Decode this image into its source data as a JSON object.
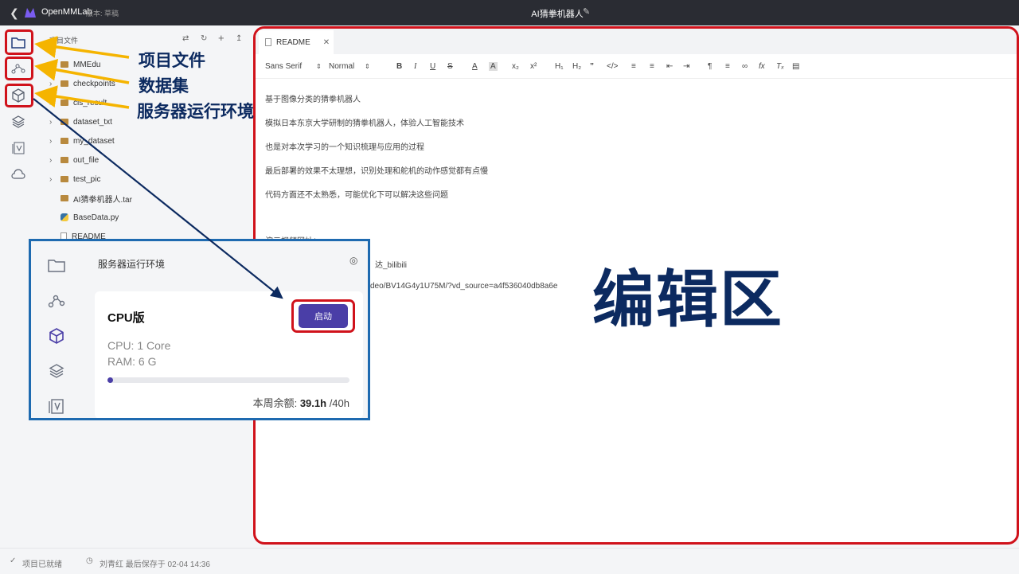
{
  "topbar": {
    "brand": "OpenMMLab",
    "version": "版本: 草稿",
    "title": "AI猜拳机器人"
  },
  "tree": {
    "title": "项目文件",
    "items": [
      {
        "type": "folder",
        "name": "MMEdu"
      },
      {
        "type": "folder",
        "name": "checkpoints"
      },
      {
        "type": "folder",
        "name": "cls_result"
      },
      {
        "type": "folder",
        "name": "dataset_txt"
      },
      {
        "type": "folder",
        "name": "my_dataset"
      },
      {
        "type": "folder",
        "name": "out_file"
      },
      {
        "type": "folder",
        "name": "test_pic"
      },
      {
        "type": "file",
        "name": "AI猜拳机器人.tar"
      },
      {
        "type": "python",
        "name": "BaseData.py"
      },
      {
        "type": "file",
        "name": "README"
      }
    ]
  },
  "annotations": {
    "project_files": "项目文件",
    "dataset": "数据集",
    "server_env": "服务器运行环境",
    "editor_area": "编辑区"
  },
  "editor": {
    "tab_label": "README",
    "toolbar": {
      "font": "Sans Serif",
      "size": "Normal",
      "h1": "H₁",
      "h2": "H₂",
      "fx": "fx"
    },
    "lines": [
      "基于图像分类的猜拳机器人",
      "模拟日本东京大学研制的猜拳机器人，体验人工智能技术",
      "也是对本次学习的一个知识梳理与应用的过程",
      "最后部署的效果不太理想，识别处理和舵机的动作感觉都有点慢",
      "代码方面还不太熟悉，可能优化下可以解决这些问题"
    ],
    "partial_lines": [
      "演示视频网址：",
      "达_bilibili",
      "/video/BV14G4y1U75M/?vd_source=a4f536040db8a6e"
    ]
  },
  "panel": {
    "title": "服务器运行环境",
    "cpu_title": "CPU版",
    "start_button": "启动",
    "cpu_spec": "CPU: 1 Core",
    "ram_spec": "RAM: 6 G",
    "quota_label": "本周余额: ",
    "quota_used": "39.1h",
    "quota_total": " /40h",
    "quota_fraction": 0.02
  },
  "status": {
    "ready": "项目已就绪",
    "saved": "刘青红 最后保存于 02-04 14:36"
  },
  "colors": {
    "accent": "#4a3ea7",
    "annotation_red": "#d0121b",
    "annotation_blue": "#1e6ab0",
    "annotation_text": "#0c2a60",
    "arrow_yellow": "#f5b400"
  }
}
